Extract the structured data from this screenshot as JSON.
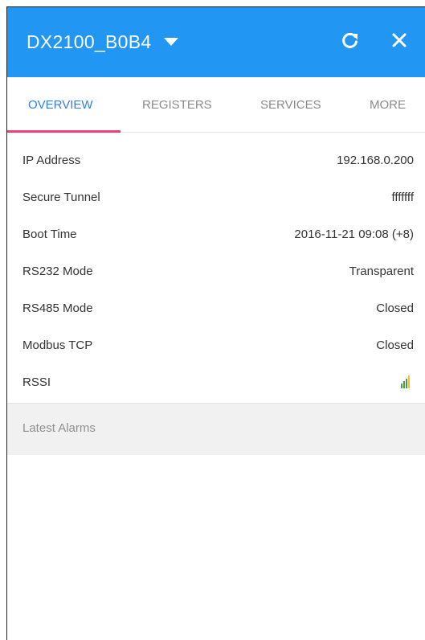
{
  "header": {
    "title": "DX2100_B0B4",
    "bg": "#2196f3",
    "icons": {
      "dropdown": "caret-down-icon",
      "refresh": "refresh-icon",
      "close": "close-icon"
    }
  },
  "tabs": [
    {
      "label": "OVERVIEW",
      "active": true
    },
    {
      "label": "REGISTERS",
      "active": false
    },
    {
      "label": "SERVICES",
      "active": false
    },
    {
      "label": "MORE",
      "active": false
    }
  ],
  "overview": [
    {
      "label": "IP Address",
      "value": "192.168.0.200"
    },
    {
      "label": "Secure Tunnel",
      "value": "fffffff"
    },
    {
      "label": "Boot Time",
      "value": "2016-11-21 09:08 (+8)"
    },
    {
      "label": "RS232 Mode",
      "value": "Transparent"
    },
    {
      "label": "RS485 Mode",
      "value": "Closed"
    },
    {
      "label": "Modbus TCP",
      "value": "Closed"
    },
    {
      "label": "RSSI",
      "value": ""
    }
  ],
  "rssi": {
    "icon": "signal-strength-icon",
    "bars": [
      {
        "color": "#43a047",
        "level": 0.35
      },
      {
        "color": "#43a047",
        "level": 0.55
      },
      {
        "color": "#43a047",
        "level": 0.75
      },
      {
        "color": "#fbc02d",
        "level": 1.0
      }
    ]
  },
  "alarms": {
    "label": "Latest Alarms"
  }
}
